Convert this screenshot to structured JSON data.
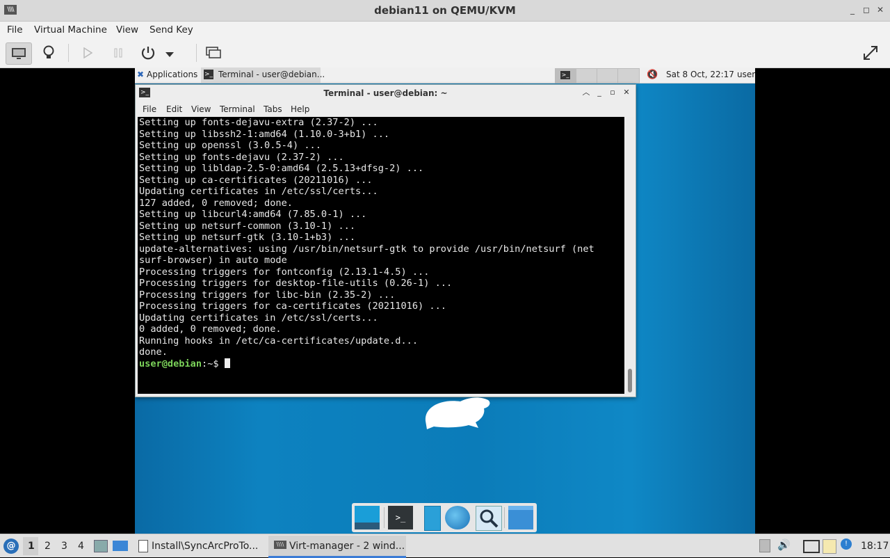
{
  "host": {
    "window_title": "debian11 on QEMU/KVM",
    "menu": [
      "File",
      "Virtual Machine",
      "View",
      "Send Key"
    ],
    "toolbar": {
      "console_icon": "monitor-icon",
      "details_icon": "lightbulb-icon",
      "run_icon": "play-icon",
      "pause_icon": "pause-icon",
      "power_icon": "power-icon",
      "power_menu_icon": "chevron-down-icon",
      "snapshots_icon": "screens-icon",
      "fullscreen_icon": "expand-icon"
    },
    "window_buttons": [
      "_",
      "▫",
      "✕"
    ]
  },
  "guest": {
    "panel": {
      "applications": "Applications",
      "task_label": "Terminal - user@debian...",
      "datetime": "Sat  8 Oct, 22:17",
      "user": "user"
    },
    "terminal": {
      "title": "Terminal - user@debian: ~",
      "menu": [
        "File",
        "Edit",
        "View",
        "Terminal",
        "Tabs",
        "Help"
      ],
      "lines": [
        "Setting up fonts-dejavu-extra (2.37-2) ...",
        "Setting up libssh2-1:amd64 (1.10.0-3+b1) ...",
        "Setting up openssl (3.0.5-4) ...",
        "Setting up fonts-dejavu (2.37-2) ...",
        "Setting up libldap-2.5-0:amd64 (2.5.13+dfsg-2) ...",
        "Setting up ca-certificates (20211016) ...",
        "Updating certificates in /etc/ssl/certs...",
        "127 added, 0 removed; done.",
        "Setting up libcurl4:amd64 (7.85.0-1) ...",
        "Setting up netsurf-common (3.10-1) ...",
        "Setting up netsurf-gtk (3.10-1+b3) ...",
        "update-alternatives: using /usr/bin/netsurf-gtk to provide /usr/bin/netsurf (net",
        "surf-browser) in auto mode",
        "Processing triggers for fontconfig (2.13.1-4.5) ...",
        "Processing triggers for desktop-file-utils (0.26-1) ...",
        "Processing triggers for libc-bin (2.35-2) ...",
        "Processing triggers for ca-certificates (20211016) ...",
        "Updating certificates in /etc/ssl/certs...",
        "0 added, 0 removed; done.",
        "Running hooks in /etc/ca-certificates/update.d...",
        "done."
      ],
      "prompt_user": "user@debian",
      "prompt_path": ":~$ "
    }
  },
  "taskbar": {
    "workspaces": [
      "1",
      "2",
      "3",
      "4"
    ],
    "tasks": [
      "Install\\SyncArcProTo...",
      "Virt-manager - 2 wind..."
    ],
    "clock": "18:17"
  }
}
